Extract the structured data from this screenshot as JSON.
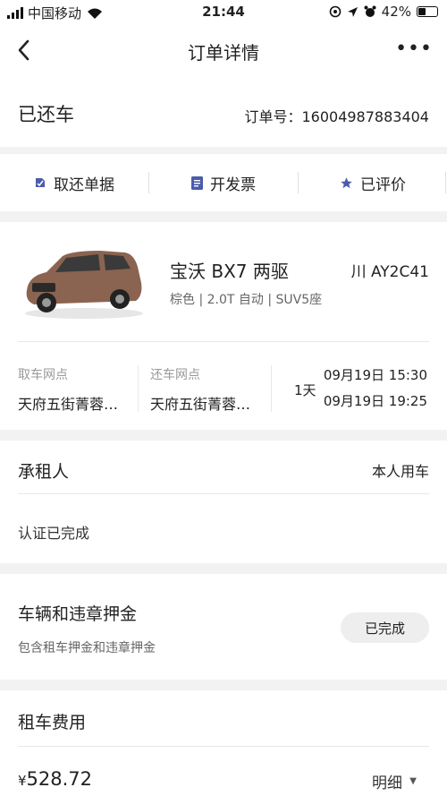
{
  "status_bar": {
    "carrier": "中国移动",
    "time": "21:44",
    "battery": "42%",
    "battery_level": 0.42
  },
  "nav": {
    "title": "订单详情",
    "back_icon": "chevron-left-icon",
    "more_label": "•••"
  },
  "order": {
    "status": "已还车",
    "number_label": "订单号：16004987883404"
  },
  "actions": [
    {
      "label": "取还单据",
      "icon": "receipt-icon"
    },
    {
      "label": "开发票",
      "icon": "invoice-icon"
    },
    {
      "label": "已评价",
      "icon": "star-icon"
    }
  ],
  "car": {
    "model": "宝沃 BX7 两驱",
    "plate": "川 AY2C41",
    "spec": "棕色 | 2.0T 自动 | SUV5座",
    "pickup_label": "取车网点",
    "pickup_value": "天府五街菁蓉…",
    "return_label": "还车网点",
    "return_value": "天府五街菁蓉…",
    "days": "1天",
    "pickup_time": "09月19日 15:30",
    "return_time": "09月19日 19:25"
  },
  "renter": {
    "title": "承租人",
    "type": "本人用车",
    "auth": "认证已完成"
  },
  "deposit": {
    "title": "车辆和违章押金",
    "subtitle": "包含租车押金和违章押金",
    "status": "已完成"
  },
  "fee": {
    "title": "租车费用",
    "currency": "¥",
    "amount": "528.72",
    "detail_label": "明细"
  },
  "colors": {
    "accent": "#4c5cab",
    "text": "#222222",
    "muted": "#999999",
    "car_body": "#8a6450"
  }
}
